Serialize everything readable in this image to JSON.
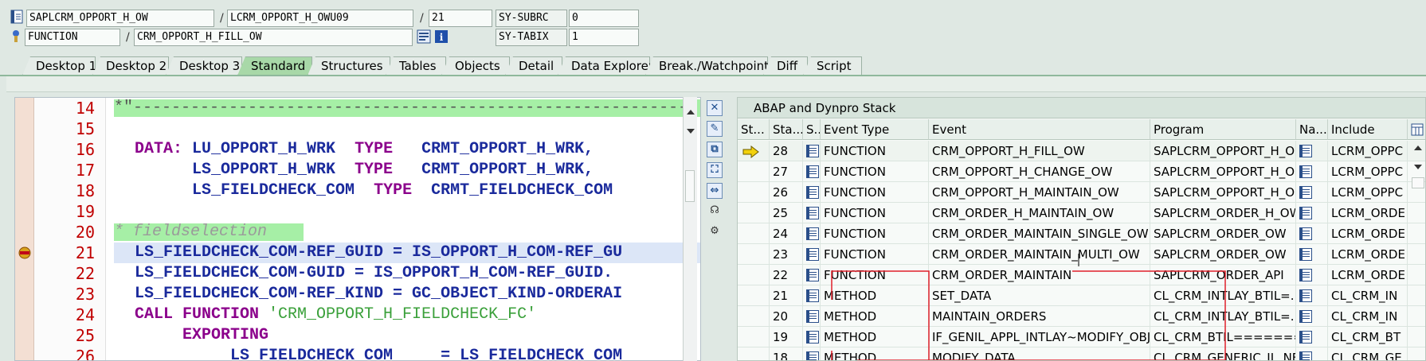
{
  "header": {
    "row1": {
      "program": "SAPLCRM_OPPORT_H_OW",
      "sep1": "/",
      "include": "LCRM_OPPORT_H_OWU09",
      "sep2": "/",
      "line": "21",
      "sysfield": "SY-SUBRC",
      "sysvalue": "0"
    },
    "row2": {
      "type": "FUNCTION",
      "sep": "/",
      "name": "CRM_OPPORT_H_FILL_OW",
      "sysfield": "SY-TABIX",
      "sysvalue": "1"
    }
  },
  "tabs": [
    {
      "label": "Desktop 1"
    },
    {
      "label": "Desktop 2"
    },
    {
      "label": "Desktop 3"
    },
    {
      "label": "Standard"
    },
    {
      "label": "Structures"
    },
    {
      "label": "Tables"
    },
    {
      "label": "Objects"
    },
    {
      "label": "Detail"
    },
    {
      "label": "Data Explorer"
    },
    {
      "label": "Break./Watchpoints"
    },
    {
      "label": "Diff"
    },
    {
      "label": "Script"
    }
  ],
  "active_tab": "Standard",
  "editor": {
    "lines": [
      {
        "n": "14"
      },
      {
        "n": "15"
      },
      {
        "n": "16",
        "p1": "DATA: ",
        "p2": "LU_OPPORT_H_WRK  ",
        "p3": "TYPE   ",
        "p4": "CRMT_OPPORT_H_WRK,"
      },
      {
        "n": "17",
        "p2": "      LS_OPPORT_H_WRK  ",
        "p3": "TYPE   ",
        "p4": "CRMT_OPPORT_H_WRK,"
      },
      {
        "n": "18",
        "p2": "      LS_FIELDCHECK_COM  ",
        "p3": "TYPE  ",
        "p4": "CRMT_FIELDCHECK_COM"
      },
      {
        "n": "19"
      },
      {
        "n": "20",
        "comment": "* fieldselection"
      },
      {
        "n": "21",
        "text": "LS_FIELDCHECK_COM-REF_GUID = IS_OPPORT_H_COM-REF_GU"
      },
      {
        "n": "22",
        "text": "LS_FIELDCHECK_COM-GUID = IS_OPPORT_H_COM-REF_GUID."
      },
      {
        "n": "23",
        "text": "LS_FIELDCHECK_COM-REF_KIND = GC_OBJECT_KIND-ORDERAI"
      },
      {
        "n": "24",
        "kw1": "CALL FUNCTION ",
        "str": "'CRM_OPPORT_H_FIELDCHECK_FC'"
      },
      {
        "n": "25",
        "kw2": "     EXPORTING"
      },
      {
        "n": "26",
        "text": "          LS_FIELDCHECK_COM     = LS_FIELDCHECK_COM"
      }
    ],
    "line14_comment": "*\"-----------------------------------------------------------"
  },
  "stack": {
    "title": "ABAP and Dynpro Stack",
    "columns": [
      "St...",
      "Sta...",
      "S..",
      "Event Type",
      "Event",
      "Program",
      "Na...",
      "Include"
    ],
    "rows": [
      {
        "level": "28",
        "type": "FUNCTION",
        "event": "CRM_OPPORT_H_FILL_OW",
        "program": "SAPLCRM_OPPORT_H_O...",
        "include": "LCRM_OPPC"
      },
      {
        "level": "27",
        "type": "FUNCTION",
        "event": "CRM_OPPORT_H_CHANGE_OW",
        "program": "SAPLCRM_OPPORT_H_O...",
        "include": "LCRM_OPPC"
      },
      {
        "level": "26",
        "type": "FUNCTION",
        "event": "CRM_OPPORT_H_MAINTAIN_OW",
        "program": "SAPLCRM_OPPORT_H_O...",
        "include": "LCRM_OPPC"
      },
      {
        "level": "25",
        "type": "FUNCTION",
        "event": "CRM_ORDER_H_MAINTAIN_OW",
        "program": "SAPLCRM_ORDER_H_OW",
        "include": "LCRM_ORDE"
      },
      {
        "level": "24",
        "type": "FUNCTION",
        "event": "CRM_ORDER_MAINTAIN_SINGLE_OW",
        "program": "SAPLCRM_ORDER_OW",
        "include": "LCRM_ORDE"
      },
      {
        "level": "23",
        "type": "FUNCTION",
        "event": "CRM_ORDER_MAINTAIN_MULTI_OW",
        "program": "SAPLCRM_ORDER_OW",
        "include": "LCRM_ORDE"
      },
      {
        "level": "22",
        "type": "FUNCTION",
        "event": "CRM_ORDER_MAINTAIN",
        "program": "SAPLCRM_ORDER_API",
        "include": "LCRM_ORDE"
      },
      {
        "level": "21",
        "type": "METHOD",
        "event": "SET_DATA",
        "program": "CL_CRM_INTLAY_BTIL=...",
        "include": "CL_CRM_IN"
      },
      {
        "level": "20",
        "type": "METHOD",
        "event": "MAINTAIN_ORDERS",
        "program": "CL_CRM_INTLAY_BTIL=...",
        "include": "CL_CRM_IN"
      },
      {
        "level": "19",
        "type": "METHOD",
        "event": "IF_GENIL_APPL_INTLAY~MODIFY_OBJ...",
        "program": "CL_CRM_BTIL========...",
        "include": "CL_CRM_BT"
      },
      {
        "level": "18",
        "type": "METHOD",
        "event": "MODIFY_DATA",
        "program": "CL_CRM_GENERIC_IL_NE...",
        "include": "CL_CRM_GE"
      }
    ]
  },
  "colors": {
    "background": "#dfe8e3",
    "active_tab": "#a8d8a8",
    "line_number": "#c00000",
    "keyword": "#8b008b",
    "identifier": "#1a2a9c",
    "string": "#3aa03a",
    "annotation": "#e0202a"
  },
  "icons": [
    "program-icon",
    "function-icon",
    "stack-list-icon",
    "info-icon",
    "breakpoint-icon",
    "current-line-arrow-icon",
    "close-icon",
    "new-icon",
    "layout-icon"
  ]
}
